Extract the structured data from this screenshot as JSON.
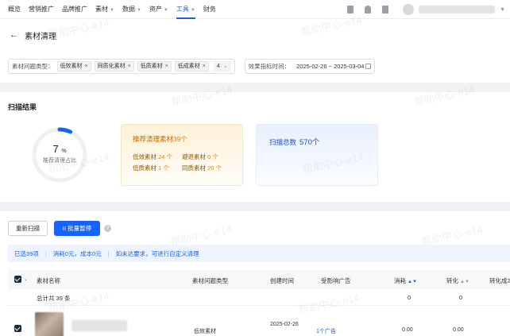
{
  "topnav": {
    "items": [
      {
        "label": "概览",
        "active": false,
        "caret": false
      },
      {
        "label": "营销推广",
        "active": false,
        "caret": false
      },
      {
        "label": "品牌推广",
        "active": false,
        "caret": false
      },
      {
        "label": "素材",
        "active": false,
        "caret": true
      },
      {
        "label": "数据",
        "active": false,
        "caret": true
      },
      {
        "label": "资产",
        "active": false,
        "caret": true
      },
      {
        "label": "工具",
        "active": true,
        "caret": true
      },
      {
        "label": "财务",
        "active": false,
        "caret": false
      }
    ],
    "accent": "#1f5fd9"
  },
  "page": {
    "title": "素材清理"
  },
  "filters": {
    "issue_label": "素材问题类型：",
    "tags": [
      "低效素材",
      "同质化素材",
      "低质素材",
      "低成素材"
    ],
    "count": "4",
    "date_label": "效果指标时间：",
    "date_range": "2025-02-26 ~ 2025-03-04"
  },
  "scan": {
    "title": "扫描结果",
    "percent": "7",
    "percent_unit": "%",
    "progress": 0.07,
    "ring_label": "推荐清理占比",
    "reco_title": "推荐清理素材",
    "reco_count": "39个",
    "reco_items": [
      {
        "label": "低效素材",
        "value": "24 个"
      },
      {
        "label": "避退素材",
        "value": "0 个"
      },
      {
        "label": "低质素材",
        "value": "1 个"
      },
      {
        "label": "同质素材",
        "value": "20 个"
      }
    ],
    "total_label": "扫描总数",
    "total_count": "570个",
    "reco_color": "#e08300",
    "total_color": "#1f4fb4"
  },
  "actions": {
    "rescan_label": "重新扫描",
    "pause_label": "II 批量暂停",
    "help_glyph": "?",
    "notice_selected": "已选39项",
    "notice_consume": "消耗0元，成本0元",
    "notice_hint": "如未达要求，可进行自定义清理"
  },
  "table": {
    "headers": {
      "name": "素材名称",
      "issue": "素材问题类型",
      "time": "创建时间",
      "ad": "受影响广告",
      "consume": "消耗",
      "convert": "转化",
      "convert_cost": "转化成本"
    },
    "total_label": "总计共 39 条",
    "total_consume": "0",
    "total_convert": "0",
    "row": {
      "issue": "低效素材",
      "time": "2025-02-26",
      "ad": "1个广告",
      "consume": "0.00",
      "convert": "0.00"
    }
  },
  "watermark": "帮助中心-e14"
}
